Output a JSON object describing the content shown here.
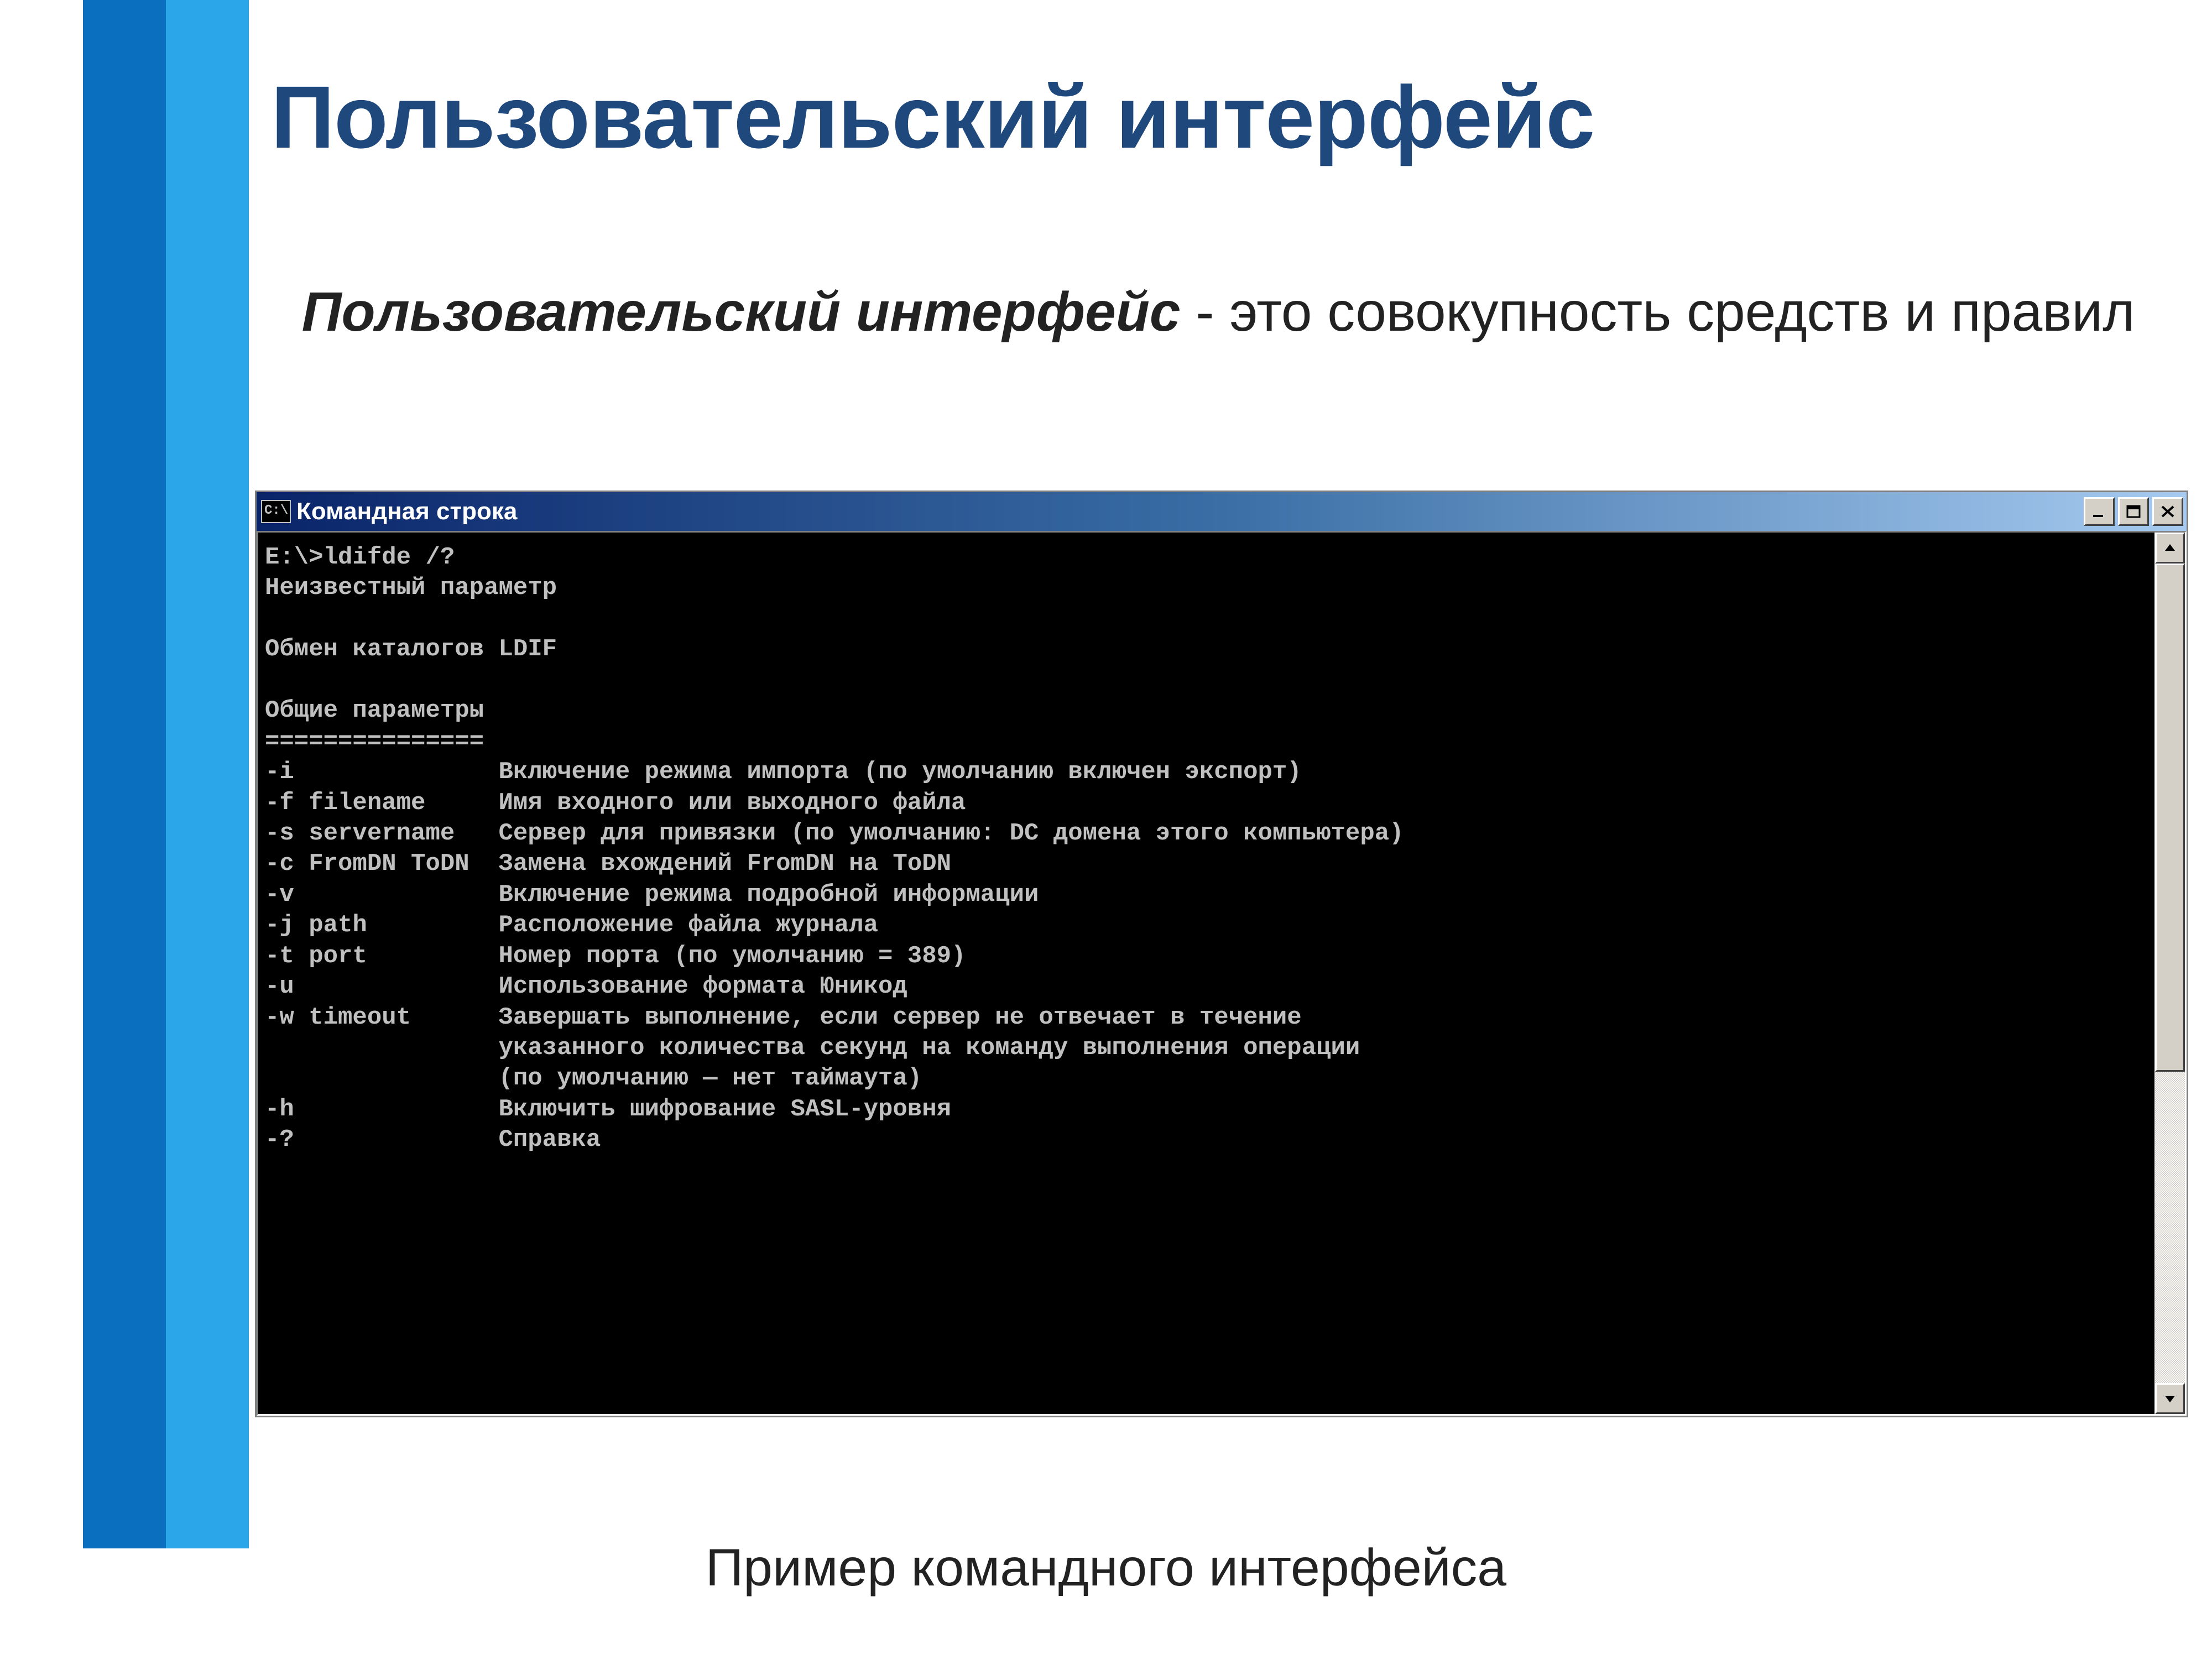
{
  "slide": {
    "title": "Пользовательский интерфейс",
    "para_strong": "Пользовательский интерфейс",
    "para_rest": " - это совокупность средств и правил",
    "caption": "Пример командного интерфейса"
  },
  "cmd": {
    "icon_text": "C:\\",
    "title": "Командная строка",
    "lines": [
      "E:\\>ldifde /?",
      "Неизвестный параметр",
      "",
      "Обмен каталогов LDIF",
      "",
      "Общие параметры",
      "===============",
      "-i              Включение режима импорта (по умолчанию включен экспорт)",
      "-f filename     Имя входного или выходного файла",
      "-s servername   Сервер для привязки (по умолчанию: DC домена этого компьютера)",
      "-c FromDN ToDN  Замена вхождений FromDN на ToDN",
      "-v              Включение режима подробной информации",
      "-j path         Расположение файла журнала",
      "-t port         Номер порта (по умолчанию = 389)",
      "-u              Использование формата Юникод",
      "-w timeout      Завершать выполнение, если сервер не отвечает в течение",
      "                указанного количества секунд на команду выполнения операции",
      "                (по умолчанию — нет таймаута)",
      "-h              Включить шифрование SASL-уровня",
      "-?              Справка",
      ""
    ]
  }
}
